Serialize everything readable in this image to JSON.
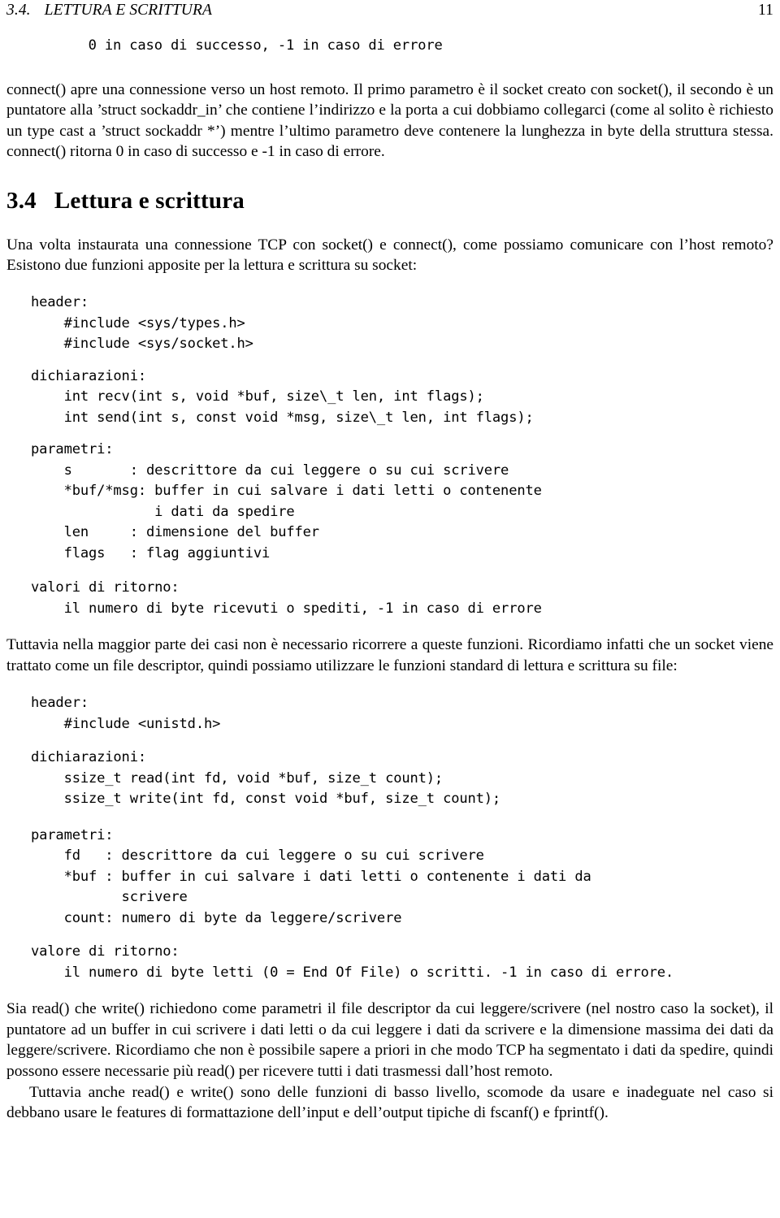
{
  "header": {
    "section_number": "3.4.",
    "section_title": "LETTURA E SCRITTURA",
    "page_number": "11"
  },
  "blocks": {
    "ret_connect": "    0 in caso di successo, -1 in caso di errore",
    "para_connect": "connect() apre una connessione verso un host remoto. Il primo parametro è il socket creato con socket(), il secondo è un puntatore alla ’struct sockaddr_in’ che contiene l’indirizzo e la porta a cui dobbiamo collegarci (come al solito è richiesto un type cast a ’struct sockaddr *’) mentre l’ultimo parametro deve contenere la lunghezza in byte della struttura stessa. connect() ritorna 0 in caso di successo e -1 in caso di errore.",
    "section_num": "3.4",
    "section_title": "Lettura e scrittura",
    "para_intro": "Una volta instaurata una connessione TCP con socket() e connect(), come possiamo comunicare con l’host remoto? Esistono due funzioni apposite per la lettura e scrittura su socket:",
    "code_header_socket": "header:\n    #include <sys/types.h>\n    #include <sys/socket.h>",
    "code_decl_socket": "dichiarazioni:\n    int recv(int s, void *buf, size\\_t len, int flags);\n    int send(int s, const void *msg, size\\_t len, int flags);",
    "code_params_socket": "parametri:\n    s       : descrittore da cui leggere o su cui scrivere\n    *buf/*msg: buffer in cui salvare i dati letti o contenente\n               i dati da spedire\n    len     : dimensione del buffer\n    flags   : flag aggiuntivi",
    "code_ret_socket": "valori di ritorno:\n    il numero di byte ricevuti o spediti, -1 in caso di errore",
    "para_filedesc": "Tuttavia nella maggior parte dei casi non è necessario ricorrere a queste funzioni. Ricordiamo infatti che un socket viene trattato come un file descriptor, quindi possiamo utilizzare le funzioni standard di lettura e scrittura su file:",
    "code_header_unistd": "header:\n    #include <unistd.h>",
    "code_decl_unistd": "dichiarazioni:\n    ssize_t read(int fd, void *buf, size_t count);\n    ssize_t write(int fd, const void *buf, size_t count);",
    "code_params_unistd": "parametri:\n    fd   : descrittore da cui leggere o su cui scrivere\n    *buf : buffer in cui salvare i dati letti o contenente i dati da\n           scrivere\n    count: numero di byte da leggere/scrivere",
    "code_ret_unistd": "valore di ritorno:\n    il numero di byte letti (0 = End Of File) o scritti. -1 in caso di errore.",
    "para_readwrite": "Sia read() che write() richiedono come parametri il file descriptor da cui leggere/scrivere (nel nostro caso la socket), il puntatore ad un buffer in cui scrivere i dati letti o da cui leggere i dati da scrivere e la dimensione massima dei dati da leggere/scrivere. Ricordiamo che non è possibile sapere a priori in che modo TCP ha segmentato i dati da spedire, quindi possono essere necessarie più read() per ricevere tutti i dati trasmessi dall’host remoto.",
    "para_lowlevel": "Tuttavia anche read() e write() sono delle funzioni di basso livello, scomode da usare e inadeguate nel caso si debbano usare le features di formattazione dell’input e dell’output tipiche di fscanf() e fprintf()."
  }
}
